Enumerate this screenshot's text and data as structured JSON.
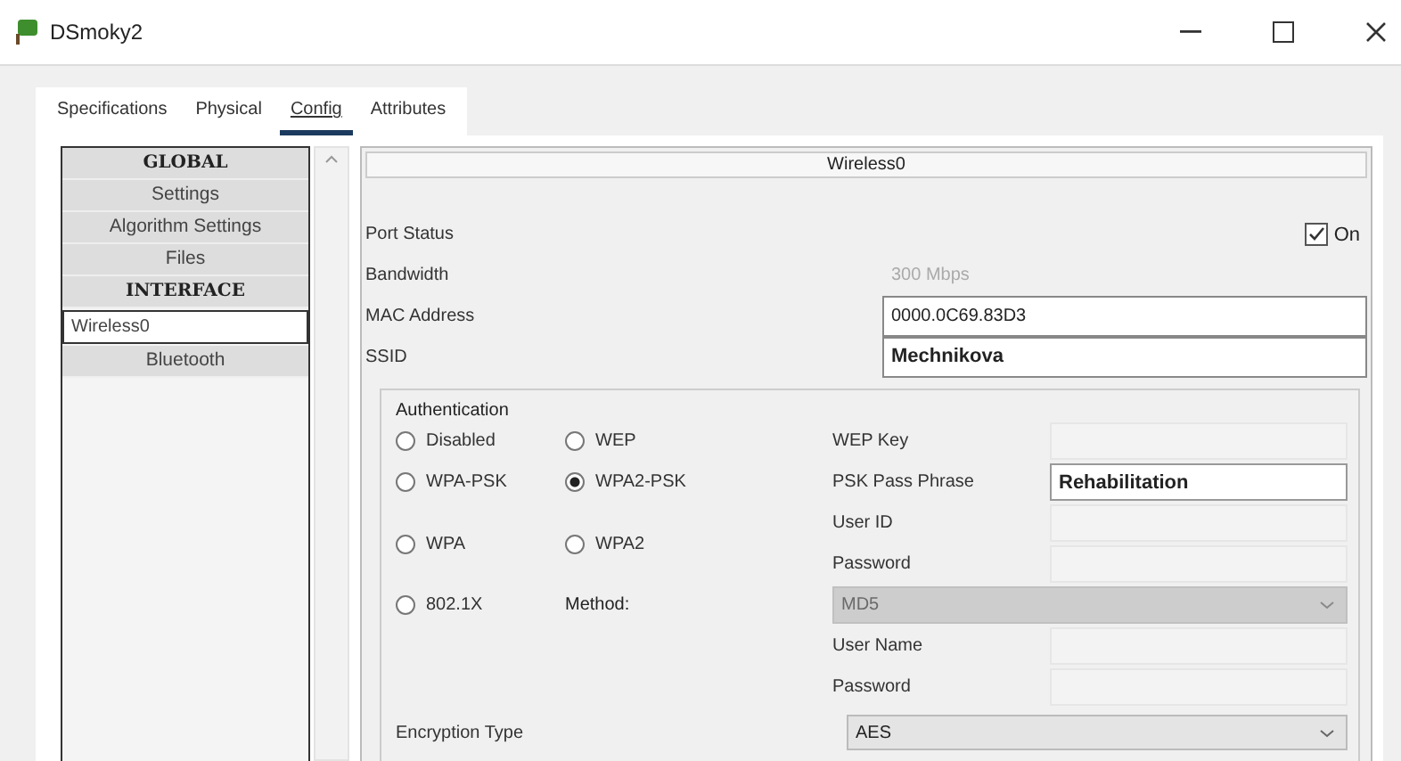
{
  "window": {
    "title": "DSmoky2"
  },
  "tabs": [
    {
      "label": "Specifications",
      "selected": false
    },
    {
      "label": "Physical",
      "selected": false
    },
    {
      "label": "Config",
      "selected": true
    },
    {
      "label": "Attributes",
      "selected": false
    }
  ],
  "sidebar": {
    "items": [
      {
        "label": "GLOBAL",
        "kind": "header",
        "selected": false
      },
      {
        "label": "Settings",
        "kind": "item",
        "selected": false
      },
      {
        "label": "Algorithm Settings",
        "kind": "item",
        "selected": false
      },
      {
        "label": "Files",
        "kind": "item",
        "selected": false
      },
      {
        "label": "INTERFACE",
        "kind": "header",
        "selected": false
      },
      {
        "label": "Wireless0",
        "kind": "item",
        "selected": true
      },
      {
        "label": "Bluetooth",
        "kind": "item",
        "selected": false
      }
    ]
  },
  "panel": {
    "title": "Wireless0",
    "port_status": {
      "label": "Port Status",
      "option": "On",
      "checked": true
    },
    "fields": [
      {
        "label": "Bandwidth",
        "value": "300 Mbps",
        "disabled": true,
        "bold": false
      },
      {
        "label": "MAC Address",
        "value": "0000.0C69.83D3",
        "disabled": false,
        "bold": false
      },
      {
        "label": "SSID",
        "value": "Mechnikova",
        "disabled": false,
        "bold": true
      }
    ],
    "authentication": {
      "title": "Authentication",
      "options": [
        {
          "label": "Disabled",
          "selected": false
        },
        {
          "label": "WEP",
          "selected": false
        },
        {
          "label": "WPA-PSK",
          "selected": false
        },
        {
          "label": "WPA2-PSK",
          "selected": true
        },
        {
          "label": "WPA",
          "selected": false
        },
        {
          "label": "WPA2",
          "selected": false
        },
        {
          "label": "802.1X",
          "selected": false
        }
      ],
      "method_label": "Method:",
      "fields": [
        {
          "label": "WEP Key",
          "kind": "input",
          "disabled": true
        },
        {
          "label": "PSK Pass Phrase",
          "kind": "input",
          "value": "Rehabilitation",
          "disabled": false
        },
        {
          "label": "User ID",
          "kind": "input",
          "disabled": true
        },
        {
          "label": "Password",
          "kind": "input",
          "disabled": true
        },
        {
          "kind": "select",
          "value": "MD5",
          "disabled": true
        },
        {
          "label": "User Name",
          "kind": "input",
          "disabled": true
        },
        {
          "label": "Password",
          "kind": "input",
          "disabled": true
        }
      ],
      "encryption": {
        "label": "Encryption Type",
        "value": "AES"
      }
    }
  }
}
